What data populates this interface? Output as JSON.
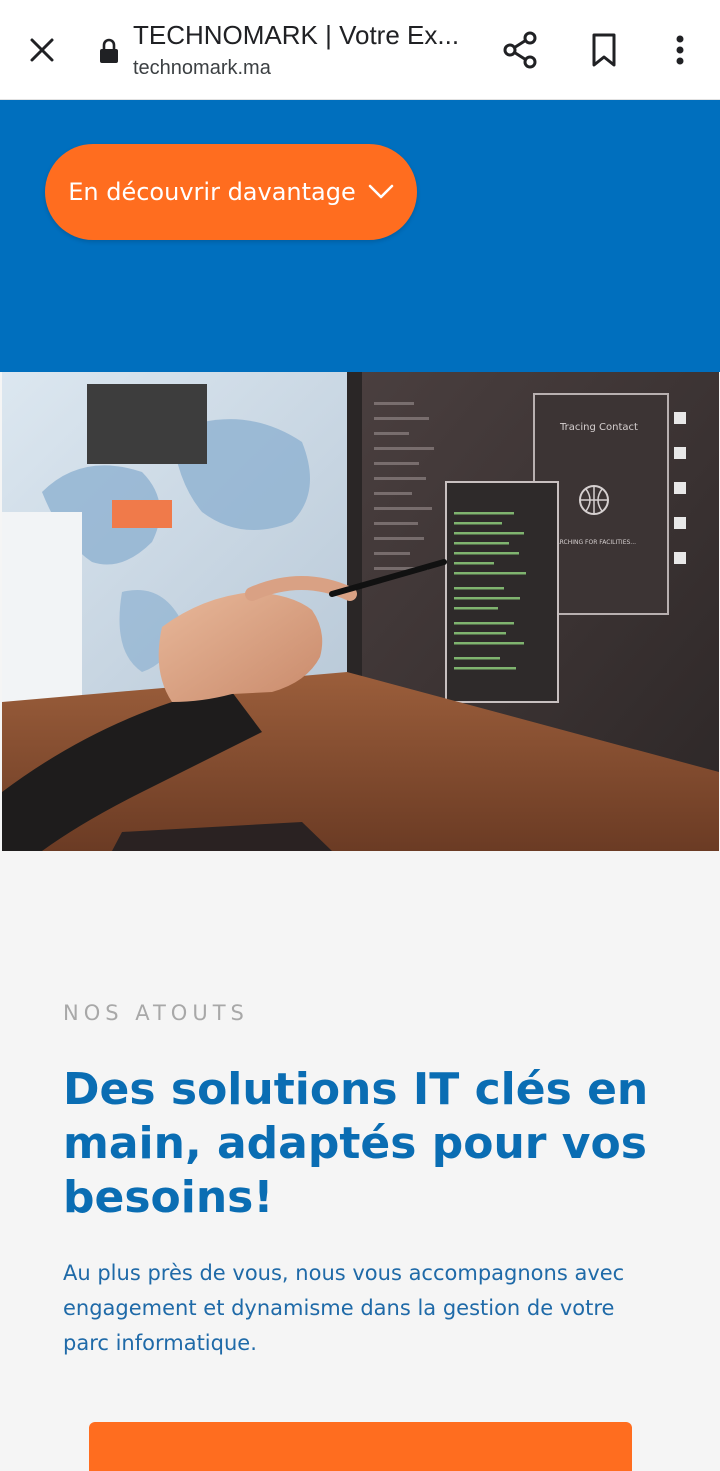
{
  "browser": {
    "title": "TECHNOMARK | Votre Ex...",
    "url": "technomark.ma",
    "icons": [
      "close-icon",
      "lock-icon",
      "share-icon",
      "bookmark-icon",
      "more-vert-icon"
    ]
  },
  "hero": {
    "cta_label": "En découvrir davantage",
    "cta_icon": "chevron-down-icon",
    "background": "#006fbe",
    "cta_color": "#ff6d1f"
  },
  "photo": {
    "window_title": "Tracing Contact",
    "window_caption": "SEARCHING FOR FACILITIES..."
  },
  "section": {
    "kicker": "NOS ATOUTS",
    "headline": "Des solutions IT clés en main, adaptés pour vos besoins!",
    "lead": "Au plus près de vous, nous vous accompagnons avec engagement et dynamisme dans la gestion de votre parc informatique.",
    "headline_color": "#0a6db3",
    "accent": "#ff6d1f"
  }
}
